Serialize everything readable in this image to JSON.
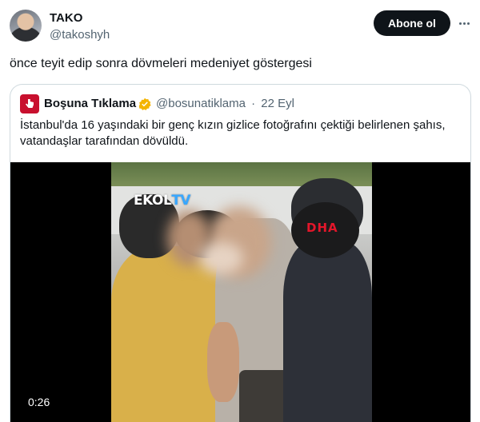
{
  "author": {
    "name": "TAKO",
    "handle": "@takoshyh"
  },
  "actions": {
    "follow_label": "Abone ol"
  },
  "tweet": {
    "text": "önce teyit edip sonra dövmeleri medeniyet göstergesi"
  },
  "quoted": {
    "name": "Boşuna Tıklama",
    "handle": "@bosunatiklama",
    "separator": "·",
    "date": "22 Eyl",
    "text": "İstanbul'da 16 yaşındaki bir genç kızın gizlice fotoğrafını çektiği belirlenen şahıs, vatandaşlar tarafından dövüldü.",
    "video": {
      "duration": "0:26",
      "watermark_left": "EKOL",
      "watermark_left_accent": "TV",
      "watermark_right": "DHA"
    }
  },
  "colors": {
    "text": "#0f1419",
    "secondary": "#536471",
    "follow_bg": "#0f1419",
    "verified": "#f4b400",
    "quote_avatar": "#c8102e"
  },
  "icons": [
    "more-icon",
    "verified-badge-icon",
    "quote-avatar-icon"
  ]
}
